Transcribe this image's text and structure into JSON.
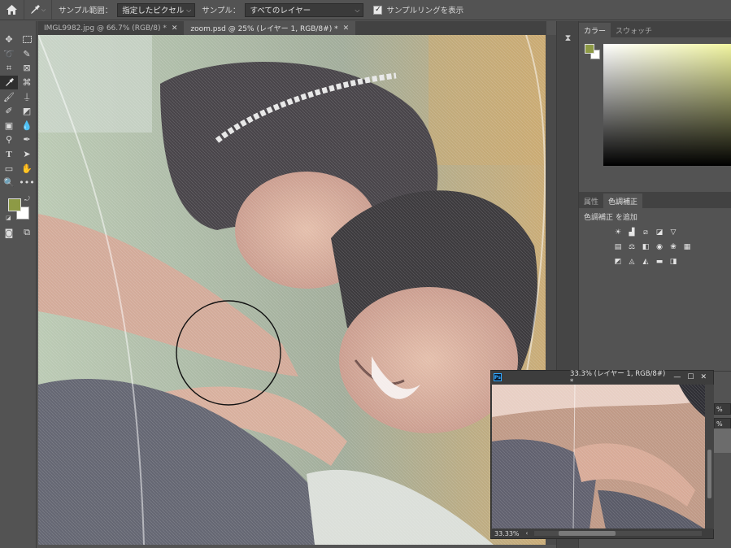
{
  "options_bar": {
    "sample_size_label": "サンプル範囲：",
    "sample_size_value": "指定したピクセル",
    "sample_label": "サンプル：",
    "sample_value": "すべてのレイヤー",
    "show_ring_label": "サンプルリングを表示",
    "show_ring_checked": true
  },
  "doc_tabs": [
    {
      "label": "IMGL9982.jpg @ 66.7% (RGB/8) *"
    },
    {
      "label": "zoom.psd @ 25% (レイヤー 1, RGB/8#) *"
    }
  ],
  "colors": {
    "foreground": "#8d9a45",
    "background": "#ffffff",
    "accent": "#31a8ff"
  },
  "color_panel": {
    "tabs": [
      "カラー",
      "スウォッチ"
    ]
  },
  "adjust_panel": {
    "tabs": [
      "属性",
      "色調補正"
    ],
    "add_label": "色調補正 を追加"
  },
  "float_window": {
    "title": "33.3% (レイヤー 1, RGB/8#) *",
    "zoom": "33.33%"
  },
  "percent_fragments": [
    "%",
    "%"
  ]
}
